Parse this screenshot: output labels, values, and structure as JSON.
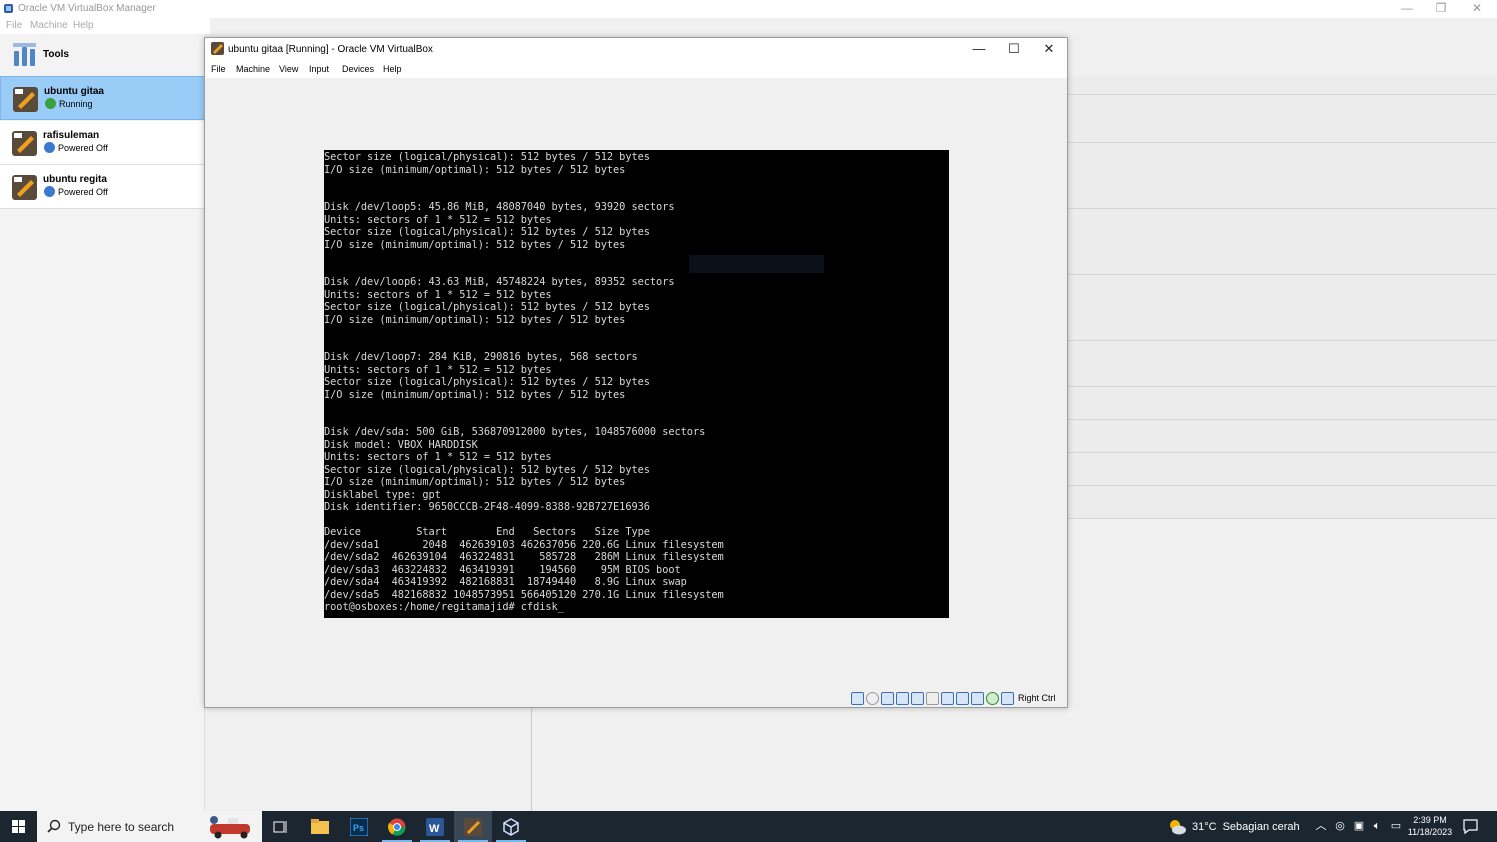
{
  "manager": {
    "title": "Oracle VM VirtualBox Manager",
    "menu": [
      "File",
      "Machine",
      "Help"
    ],
    "tools_label": "Tools",
    "vms": [
      {
        "name": "ubuntu gitaa",
        "state": "Running",
        "state_color": "#3aa040",
        "selected": true
      },
      {
        "name": "rafisuleman",
        "state": "Powered Off",
        "state_color": "#3b78d0",
        "selected": false
      },
      {
        "name": "ubuntu regita",
        "state": "Powered Off",
        "state_color": "#3b78d0",
        "selected": false
      }
    ]
  },
  "vm_window": {
    "title": "ubuntu gitaa [Running] - Oracle VM VirtualBox",
    "menu": [
      "File",
      "Machine",
      "View",
      "Input",
      "Devices",
      "Help"
    ],
    "host_key": "Right Ctrl"
  },
  "terminal": {
    "lines": [
      "Sector size (logical/physical): 512 bytes / 512 bytes",
      "I/O size (minimum/optimal): 512 bytes / 512 bytes",
      "",
      "",
      "Disk /dev/loop5: 45.86 MiB, 48087040 bytes, 93920 sectors",
      "Units: sectors of 1 * 512 = 512 bytes",
      "Sector size (logical/physical): 512 bytes / 512 bytes",
      "I/O size (minimum/optimal): 512 bytes / 512 bytes",
      "",
      "",
      "Disk /dev/loop6: 43.63 MiB, 45748224 bytes, 89352 sectors",
      "Units: sectors of 1 * 512 = 512 bytes",
      "Sector size (logical/physical): 512 bytes / 512 bytes",
      "I/O size (minimum/optimal): 512 bytes / 512 bytes",
      "",
      "",
      "Disk /dev/loop7: 284 KiB, 290816 bytes, 568 sectors",
      "Units: sectors of 1 * 512 = 512 bytes",
      "Sector size (logical/physical): 512 bytes / 512 bytes",
      "I/O size (minimum/optimal): 512 bytes / 512 bytes",
      "",
      "",
      "Disk /dev/sda: 500 GiB, 536870912000 bytes, 1048576000 sectors",
      "Disk model: VBOX HARDDISK",
      "Units: sectors of 1 * 512 = 512 bytes",
      "Sector size (logical/physical): 512 bytes / 512 bytes",
      "I/O size (minimum/optimal): 512 bytes / 512 bytes",
      "Disklabel type: gpt",
      "Disk identifier: 9650CCCB-2F48-4099-8388-92B727E16936",
      "",
      "Device         Start        End   Sectors   Size Type",
      "/dev/sda1       2048  462639103 462637056 220.6G Linux filesystem",
      "/dev/sda2  462639104  463224831    585728   286M Linux filesystem",
      "/dev/sda3  463224832  463419391    194560    95M BIOS boot",
      "/dev/sda4  463419392  482168831  18749440   8.9G Linux swap",
      "/dev/sda5  482168832 1048573951 566405120 270.1G Linux filesystem",
      "root@osboxes:/home/regitamajid# cfdisk_"
    ]
  },
  "taskbar": {
    "search_placeholder": "Type here to search",
    "apps": [
      "task-view",
      "file-explorer",
      "photoshop",
      "chrome",
      "word",
      "virtualbox-manager",
      "virtualbox-vm"
    ],
    "weather_temp": "31°C",
    "weather_desc": "Sebagian cerah",
    "time": "2:39 PM",
    "date": "11/18/2023"
  }
}
